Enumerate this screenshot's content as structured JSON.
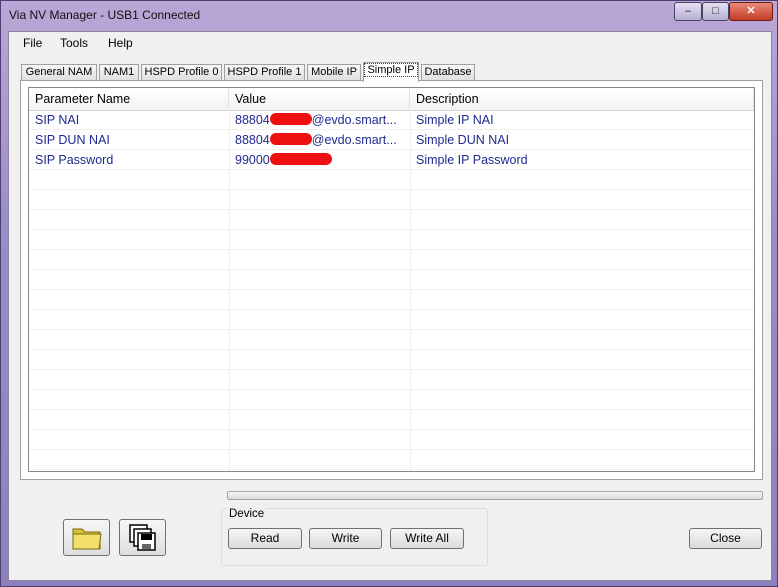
{
  "window": {
    "title": "Via NV Manager - USB1 Connected"
  },
  "menu": [
    "File",
    "Tools",
    "Help"
  ],
  "tabs": [
    "General NAM",
    "NAM1",
    "HSPD Profile 0",
    "HSPD Profile 1",
    "Mobile IP",
    "Simple IP",
    "Database"
  ],
  "active_tab": "Simple IP",
  "table": {
    "columns": [
      "Parameter Name",
      "Value",
      "Description"
    ],
    "rows": [
      {
        "name": "SIP NAI",
        "value_prefix": "88804",
        "value_suffix": "@evdo.smart...",
        "description": "Simple IP NAI"
      },
      {
        "name": "SIP DUN NAI",
        "value_prefix": "88804",
        "value_suffix": "@evdo.smart...",
        "description": "Simple DUN NAI"
      },
      {
        "name": "SIP Password",
        "value_prefix": "99000",
        "value_suffix": "",
        "description": "Simple IP Password"
      }
    ]
  },
  "device_group": {
    "label": "Device",
    "read": "Read",
    "write": "Write",
    "write_all": "Write All"
  },
  "close_label": "Close",
  "icons": {
    "open": "folder-icon",
    "save": "save-disks-icon"
  }
}
